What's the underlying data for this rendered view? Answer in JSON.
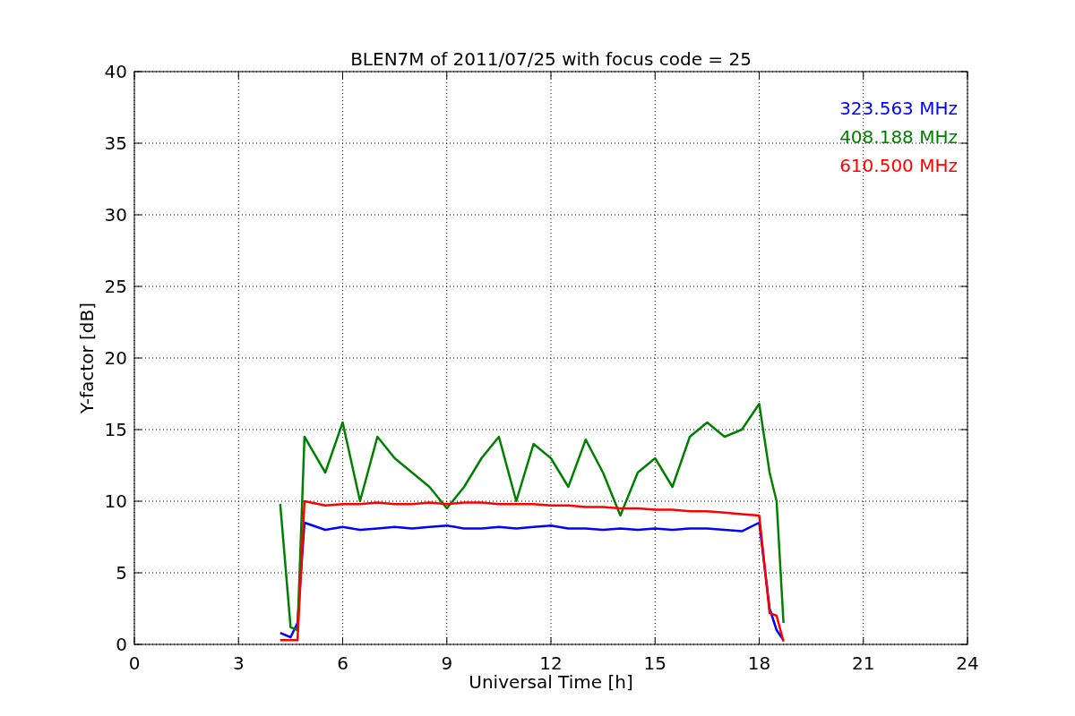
{
  "figure": {
    "chart_data": {
      "type": "line",
      "grid": true,
      "title": "BLEN7M of 2011/07/25 with focus code = 25",
      "xlabel": "Universal Time [h]",
      "ylabel": "Y-factor [dB]",
      "xlim": [
        0,
        24
      ],
      "ylim": [
        0,
        40
      ],
      "xticks": [
        0,
        3,
        6,
        9,
        12,
        15,
        18,
        21,
        24
      ],
      "yticks": [
        0,
        5,
        10,
        15,
        20,
        25,
        30,
        35,
        40
      ],
      "x": [
        4.2,
        4.5,
        4.7,
        4.9,
        5.5,
        6,
        6.5,
        7,
        7.5,
        8,
        8.5,
        9,
        9.5,
        10,
        10.5,
        11,
        11.5,
        12,
        12.5,
        13,
        13.5,
        14,
        14.5,
        15,
        15.5,
        16,
        16.5,
        17,
        17.5,
        18,
        18.3,
        18.5,
        18.7
      ],
      "series": [
        {
          "name": "323.563 MHz",
          "color": "#0000ff",
          "values": [
            0.8,
            0.5,
            1.5,
            8.5,
            8.0,
            8.2,
            8.0,
            8.1,
            8.2,
            8.1,
            8.2,
            8.3,
            8.1,
            8.1,
            8.2,
            8.1,
            8.2,
            8.3,
            8.1,
            8.1,
            8.0,
            8.1,
            8.0,
            8.1,
            8.0,
            8.1,
            8.1,
            8.0,
            7.9,
            8.5,
            2.5,
            1.0,
            0.3
          ]
        },
        {
          "name": "408.188 MHz",
          "color": "#008000",
          "values": [
            9.8,
            1.2,
            1.0,
            14.5,
            12,
            15.5,
            10,
            14.5,
            13,
            12,
            11,
            9.5,
            11,
            13,
            14.5,
            10,
            14,
            13,
            11,
            14.3,
            12,
            9,
            12,
            13,
            11,
            14.5,
            15.5,
            14.5,
            15,
            16.8,
            12,
            10,
            1.5
          ]
        },
        {
          "name": "610.500 MHz",
          "color": "#ff0000",
          "values": [
            0.3,
            0.3,
            0.3,
            10.0,
            9.7,
            9.8,
            9.8,
            9.9,
            9.8,
            9.8,
            9.9,
            9.8,
            9.9,
            9.9,
            9.8,
            9.8,
            9.8,
            9.7,
            9.7,
            9.6,
            9.6,
            9.5,
            9.5,
            9.4,
            9.4,
            9.3,
            9.3,
            9.2,
            9.1,
            9.0,
            2.2,
            2.0,
            0.2
          ]
        }
      ]
    }
  }
}
